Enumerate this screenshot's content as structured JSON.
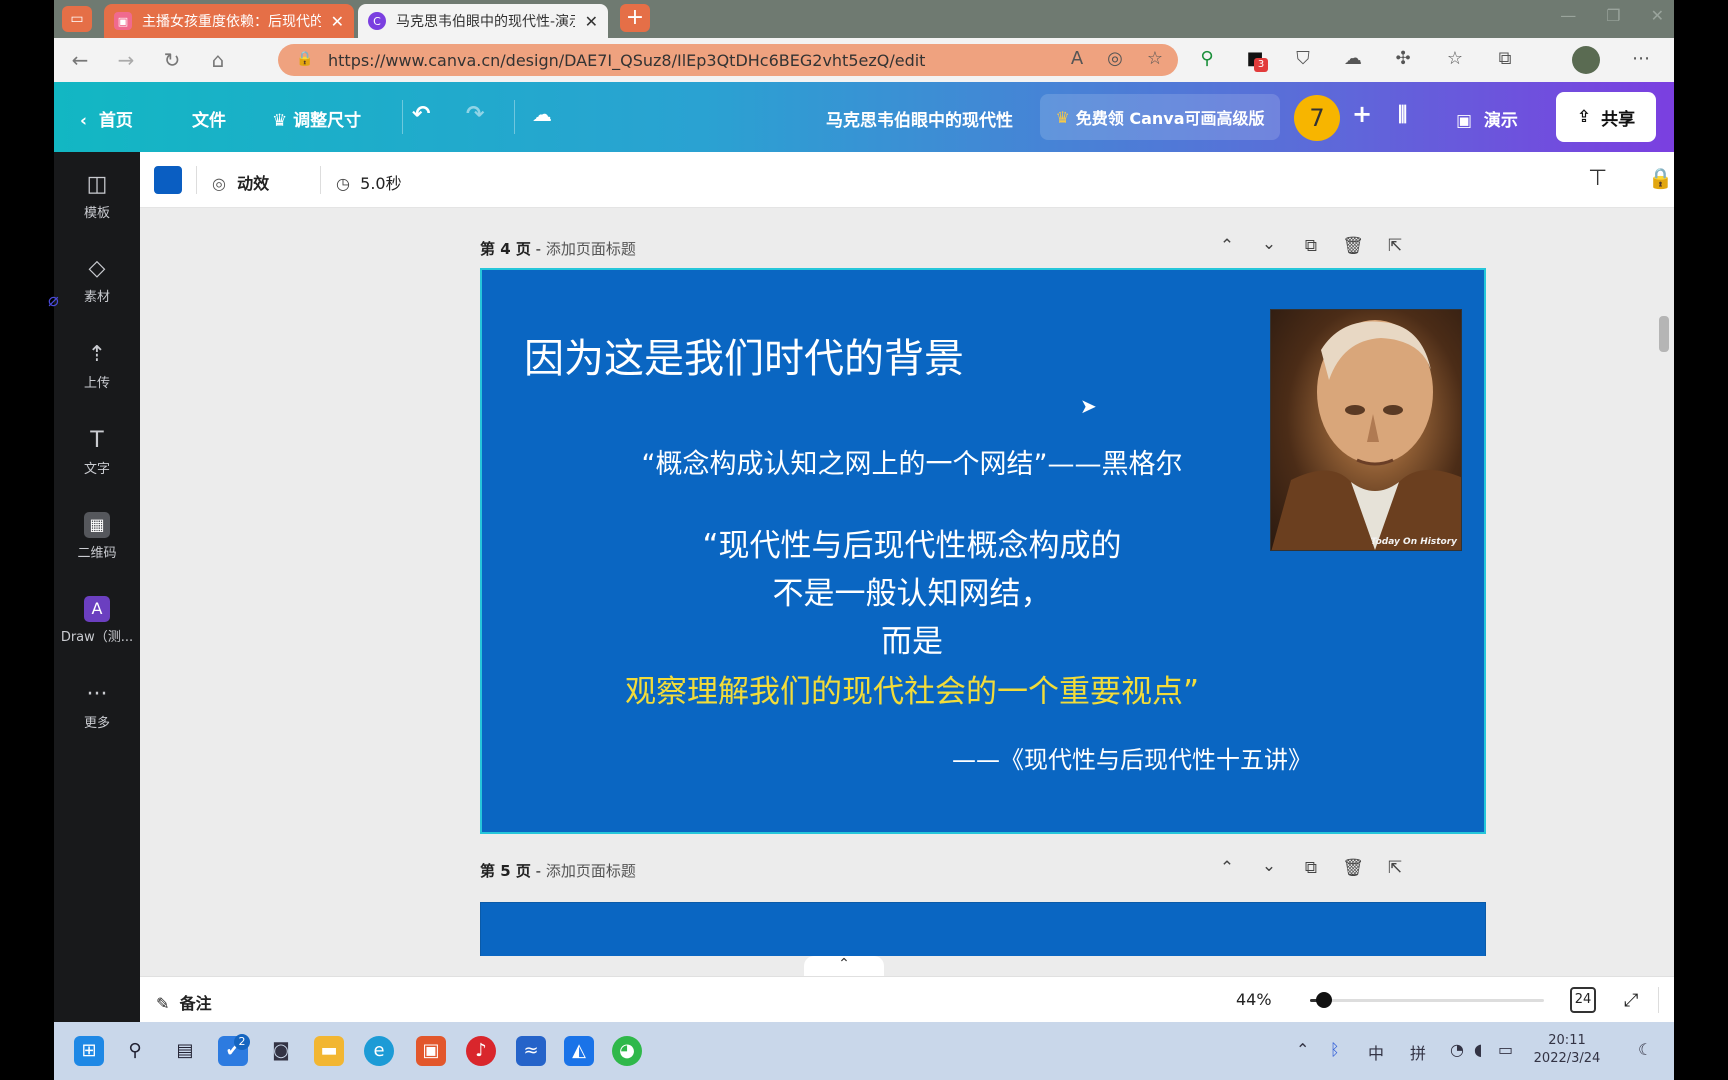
{
  "browser": {
    "tabs": [
      {
        "title": "主播女孩重度依赖：后现代的精",
        "active": false
      },
      {
        "title": "马克思韦伯眼中的现代性-演示文",
        "active": true
      }
    ],
    "new_tab": "+",
    "url": "https://www.canva.cn/design/DAE7I_QSuz8/IlEp3QtDHc6BEG2vht5ezQ/edit",
    "notification_badge": "3"
  },
  "canva": {
    "header": {
      "home": "首页",
      "file": "文件",
      "resize": "调整尺寸",
      "doc_title": "马克思韦伯眼中的现代性",
      "promo": "免费领 Canva可画高级版",
      "avatar_number": "7",
      "add": "+",
      "present": "演示",
      "share": "共享"
    },
    "sidebar": [
      {
        "label": "模板",
        "icon": "template-icon"
      },
      {
        "label": "素材",
        "icon": "elements-icon"
      },
      {
        "label": "上传",
        "icon": "upload-icon"
      },
      {
        "label": "文字",
        "icon": "text-icon"
      },
      {
        "label": "二维码",
        "icon": "qr-code-icon"
      },
      {
        "label": "Draw（测...",
        "icon": "draw-icon"
      },
      {
        "label": "更多",
        "icon": "more-icon"
      }
    ],
    "context_toolbar": {
      "color": "#0a5ec2",
      "animate": "动效",
      "duration": "5.0秒"
    },
    "pages": [
      {
        "number": "第 4 页",
        "title_placeholder": "添加页面标题"
      },
      {
        "number": "第 5 页",
        "title_placeholder": "添加页面标题"
      }
    ],
    "slide": {
      "title": "因为这是我们时代的背景",
      "quote1": "“概念构成认知之网上的一个网结”——黑格尔",
      "quote2_lines": [
        "“现代性与后现代性概念构成的",
        "不是一般认知网结，",
        "而是"
      ],
      "quote2_highlight": "观察理解我们的现代社会的一个重要视点”",
      "source": "——《现代性与后现代性十五讲》",
      "portrait_caption": "Today On History",
      "background": "#0a66c2",
      "highlight_color": "#f2dc3a"
    },
    "footer": {
      "notes": "备注",
      "zoom": "44%",
      "zoom_level": 0.06,
      "page_count": "24"
    }
  },
  "taskbar": {
    "notification_count": "2",
    "ime_lang": "中",
    "ime_mode": "拼",
    "time": "20:11",
    "date": "2022/3/24"
  }
}
